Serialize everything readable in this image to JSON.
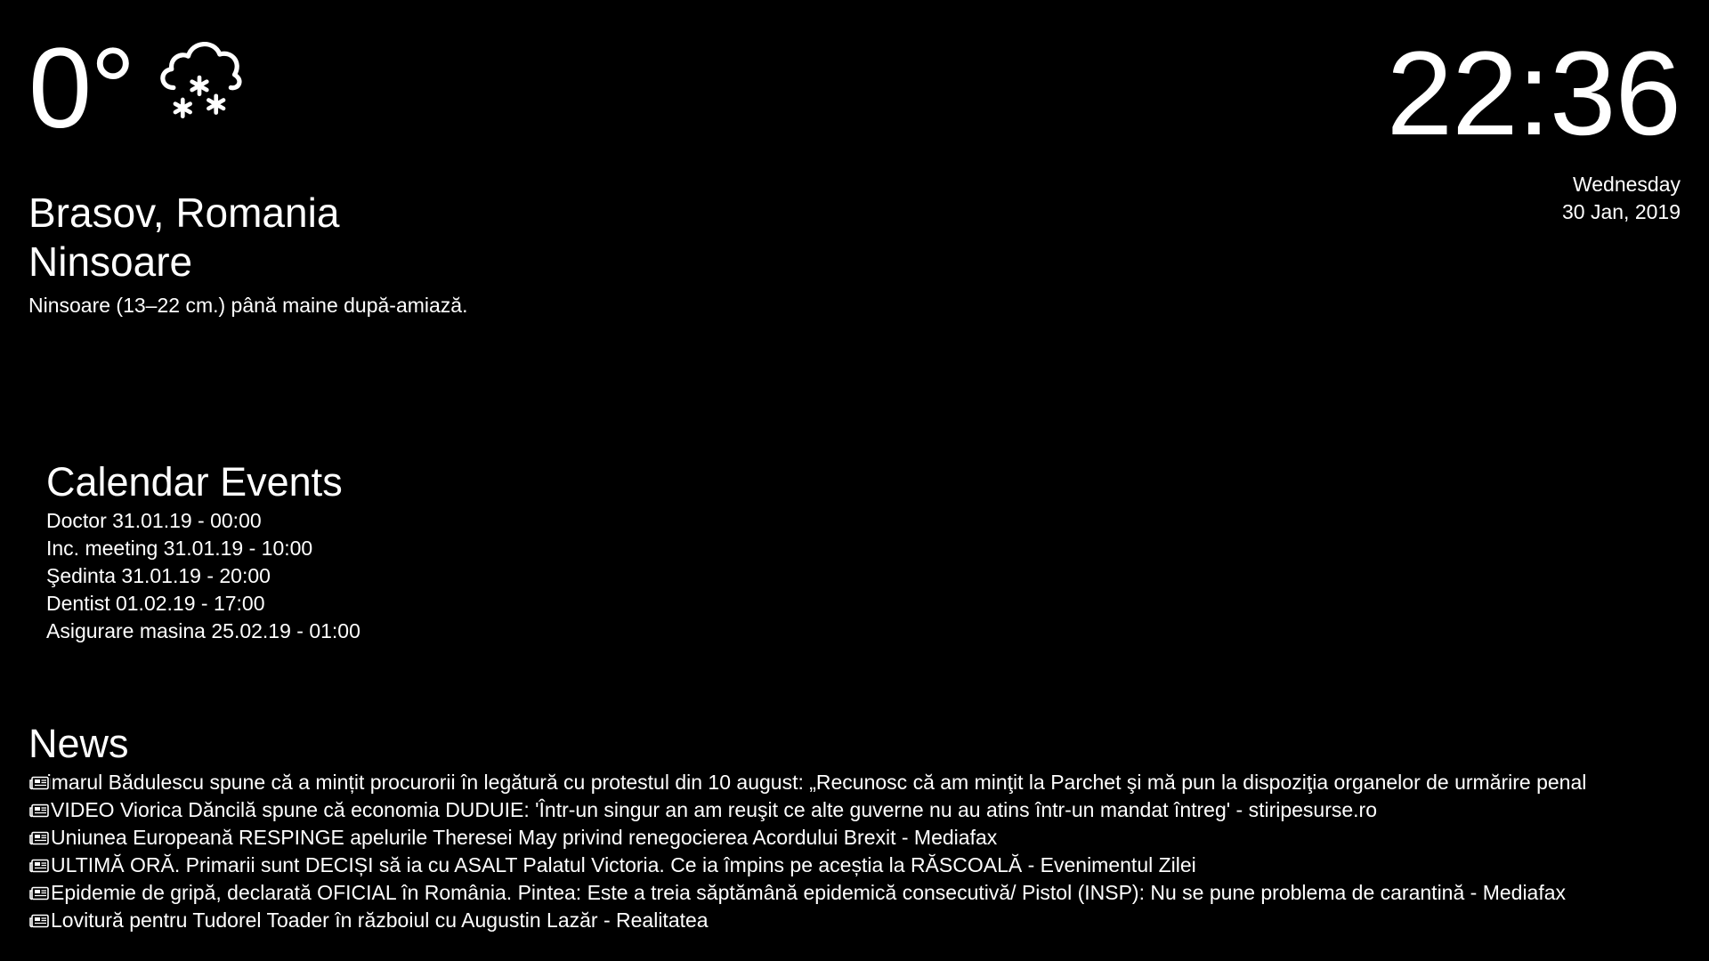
{
  "weather": {
    "temperature": "0°",
    "icon": "snow-cloud-icon",
    "location": "Brasov, Romania",
    "condition": "Ninsoare",
    "summary": "Ninsoare (13–22 cm.) până maine după-amiază."
  },
  "clock": {
    "time": "22:36",
    "day": "Wednesday",
    "date": "30 Jan, 2019"
  },
  "calendar": {
    "title": "Calendar Events",
    "events": [
      "Doctor 31.01.19 - 00:00",
      "Inc. meeting 31.01.19 - 10:00",
      "Şedinta 31.01.19 - 20:00",
      "Dentist 01.02.19 - 17:00",
      "Asigurare masina 25.02.19 - 01:00"
    ]
  },
  "news": {
    "title": "News",
    "icon": "newspaper-icon",
    "items": [
      "rimarul Bădulescu spune că a mințit procurorii în legătură cu protestul din 10 august: „Recunosc că am minţit la Parchet şi mă pun la dispoziţia organelor de urmărire penal",
      "VIDEO Viorica Dăncilă spune că economia DUDUIE: 'Într-un singur an am reuşit ce alte guverne nu au atins într-un mandat întreg' - stiripesurse.ro",
      "Uniunea Europeană RESPINGE apelurile Theresei May privind renegocierea Acordului Brexit - Mediafax",
      "ULTIMĂ ORĂ. Primarii sunt DECIȘI să ia cu ASALT Palatul Victoria. Ce ia împins pe aceștia la RĂSCOALĂ - Evenimentul Zilei",
      "Epidemie de gripă, declarată OFICIAL în România. Pintea: Este a treia săptămână epidemică consecutivă/ Pistol (INSP): Nu se pune problema de carantină - Mediafax",
      "Lovitură pentru Tudorel Toader în războiul cu Augustin Lazăr - Realitatea"
    ]
  }
}
